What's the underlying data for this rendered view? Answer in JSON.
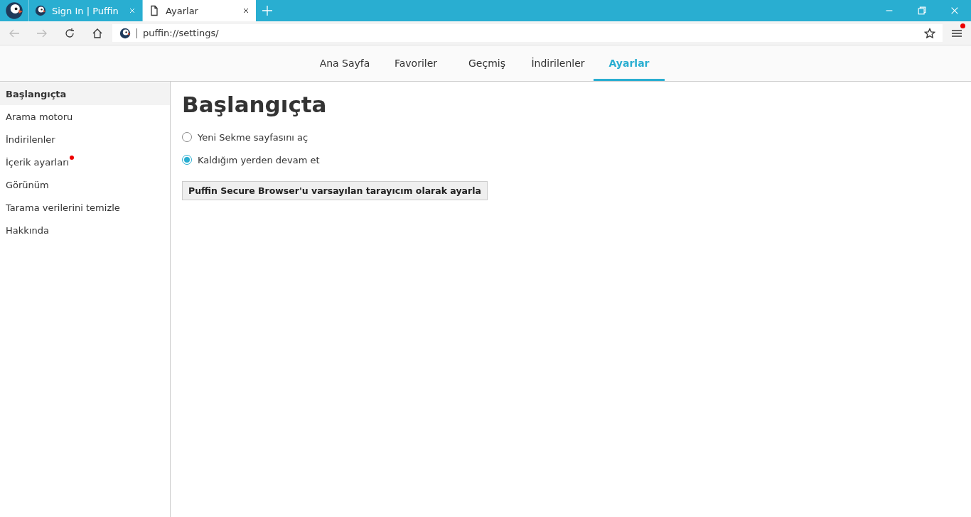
{
  "browser_tabs": [
    {
      "title": "Sign In | Puffin",
      "kind": "site",
      "selected": false
    },
    {
      "title": "Ayarlar",
      "kind": "page",
      "selected": true
    }
  ],
  "address": "puffin://settings/",
  "menu": {
    "notification": true
  },
  "nav_tabs": [
    {
      "label": "Ana Sayfa",
      "selected": false
    },
    {
      "label": "Favoriler",
      "selected": false
    },
    {
      "label": "Geçmiş",
      "selected": false
    },
    {
      "label": "İndirilenler",
      "selected": false
    },
    {
      "label": "Ayarlar",
      "selected": true
    }
  ],
  "sidebar": {
    "items": [
      {
        "label": "Başlangıçta",
        "selected": true,
        "notification": false
      },
      {
        "label": "Arama motoru",
        "selected": false,
        "notification": false
      },
      {
        "label": "İndirilenler",
        "selected": false,
        "notification": false
      },
      {
        "label": "İçerik ayarları",
        "selected": false,
        "notification": true
      },
      {
        "label": "Görünüm",
        "selected": false,
        "notification": false
      },
      {
        "label": "Tarama verilerini temizle",
        "selected": false,
        "notification": false
      },
      {
        "label": "Hakkında",
        "selected": false,
        "notification": false
      }
    ]
  },
  "content": {
    "heading": "Başlangıçta",
    "options": [
      {
        "label": "Yeni Sekme sayfasını aç",
        "selected": false
      },
      {
        "label": "Kaldığım yerden devam et",
        "selected": true
      }
    ],
    "button": "Puffin Secure Browser'u varsayılan tarayıcım olarak ayarla"
  }
}
